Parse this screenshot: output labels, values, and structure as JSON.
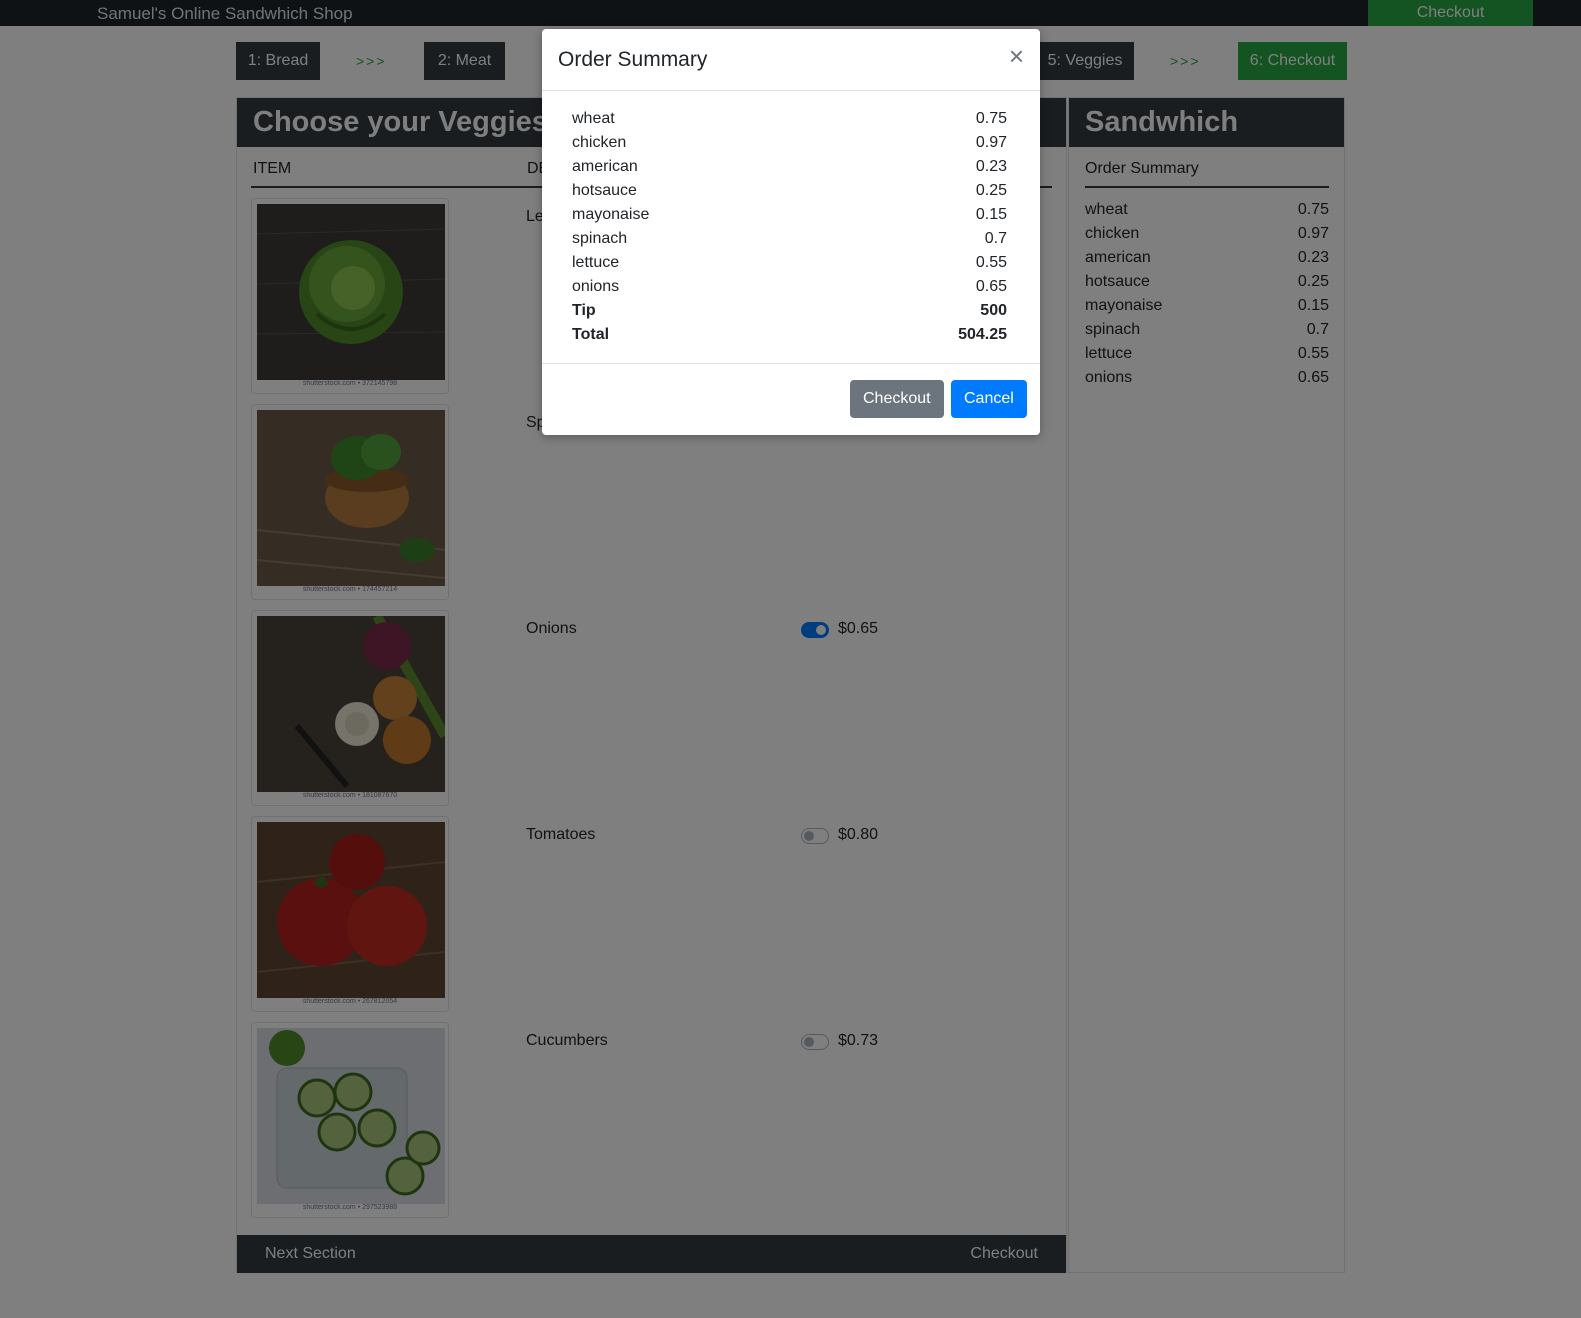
{
  "navbar": {
    "brand": "Samuel's Online Sandwhich Shop",
    "checkout": "Checkout"
  },
  "steps": [
    {
      "label": "1: Bread",
      "style": "dark"
    },
    {
      "label": "2: Meat",
      "style": "dark"
    },
    {
      "label": "5: Veggies",
      "style": "dark"
    },
    {
      "label": "6: Checkout",
      "style": "green"
    }
  ],
  "step_arrow": ">>>",
  "main": {
    "title": "Choose your Veggies",
    "col_item": "ITEM",
    "col_desc": "DE",
    "veggies": [
      {
        "name": "Le",
        "image": "lettuce-photo",
        "caption": "shutterstock.com • 372145798"
      },
      {
        "name": "Sp",
        "image": "spinach-photo",
        "caption": "shutterstock.com • 174457214"
      },
      {
        "name": "Onions",
        "price": "$0.65",
        "selected": true,
        "image": "onions-photo",
        "caption": "shutterstock.com • 181087670"
      },
      {
        "name": "Tomatoes",
        "price": "$0.80",
        "selected": false,
        "image": "tomatoes-photo",
        "caption": "shutterstock.com • 267812054"
      },
      {
        "name": "Cucumbers",
        "price": "$0.73",
        "selected": false,
        "image": "cucumbers-photo",
        "caption": "shutterstock.com • 297523988"
      }
    ],
    "footer_next": "Next Section",
    "footer_checkout": "Checkout"
  },
  "side": {
    "title": "Sandwhich",
    "subtitle": "Order Summary",
    "items": [
      {
        "name": "wheat",
        "price": "0.75"
      },
      {
        "name": "chicken",
        "price": "0.97"
      },
      {
        "name": "american",
        "price": "0.23"
      },
      {
        "name": "hotsauce",
        "price": "0.25"
      },
      {
        "name": "mayonaise",
        "price": "0.15"
      },
      {
        "name": "spinach",
        "price": "0.7"
      },
      {
        "name": "lettuce",
        "price": "0.55"
      },
      {
        "name": "onions",
        "price": "0.65"
      }
    ]
  },
  "modal": {
    "title": "Order Summary",
    "close": "×",
    "items": [
      {
        "name": "wheat",
        "price": "0.75"
      },
      {
        "name": "chicken",
        "price": "0.97"
      },
      {
        "name": "american",
        "price": "0.23"
      },
      {
        "name": "hotsauce",
        "price": "0.25"
      },
      {
        "name": "mayonaise",
        "price": "0.15"
      },
      {
        "name": "spinach",
        "price": "0.7"
      },
      {
        "name": "lettuce",
        "price": "0.55"
      },
      {
        "name": "onions",
        "price": "0.65"
      }
    ],
    "tip_label": "Tip",
    "tip_value": "500",
    "total_label": "Total",
    "total_value": "504.25",
    "checkout_button": "Checkout",
    "cancel_button": "Cancel"
  },
  "colors": {
    "dark": "#343a40",
    "navbar": "#1f2429",
    "success": "#28a745",
    "primary": "#007bff",
    "secondary": "#6c757d"
  }
}
